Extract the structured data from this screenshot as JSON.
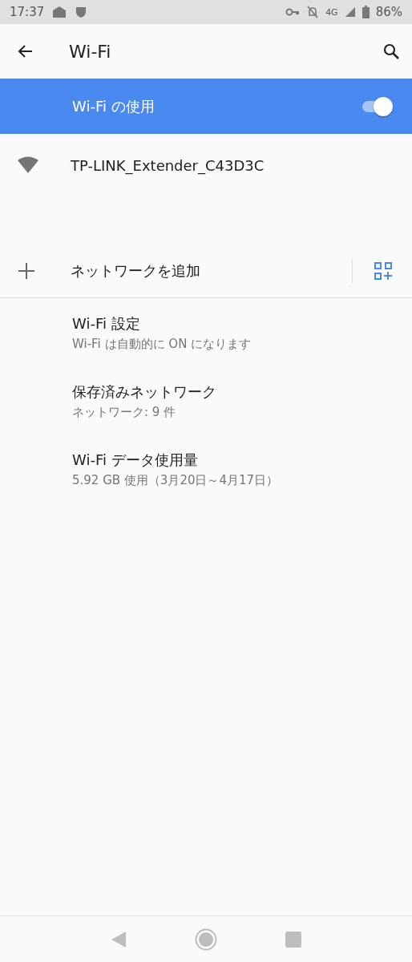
{
  "status_bar": {
    "time": "17:37",
    "network": "4G",
    "battery": "86%"
  },
  "app_bar": {
    "title": "Wi-Fi"
  },
  "master_switch": {
    "label": "Wi-Fi の使用",
    "on": true
  },
  "networks": [
    {
      "name": "TP-LINK_Extender_C43D3C"
    }
  ],
  "add_network": {
    "label": "ネットワークを追加"
  },
  "settings": [
    {
      "title": "Wi-Fi 設定",
      "summary": "Wi-Fi は自動的に ON になります"
    },
    {
      "title": "保存済みネットワーク",
      "summary": "ネットワーク: 9 件"
    },
    {
      "title": "Wi-Fi データ使用量",
      "summary": "5.92 GB 使用（3月20日～4月17日）"
    }
  ]
}
